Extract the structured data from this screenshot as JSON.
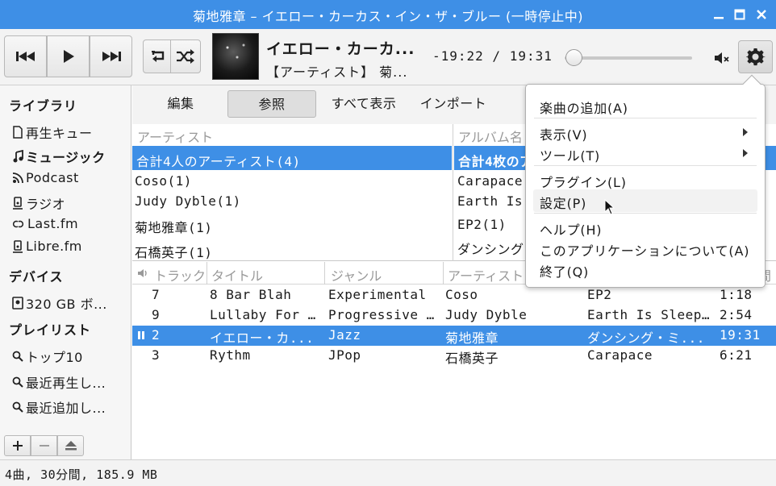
{
  "window": {
    "title": "菊地雅章 – イエロー・カーカス・イン・ザ・ブルー (一時停止中)"
  },
  "player": {
    "song_title": "イエロー・カーカ...",
    "song_artist": "【アーティスト】 菊...",
    "time": "-19:22 / 19:31",
    "progress": 0.006
  },
  "sidebar": {
    "library_header": "ライブラリ",
    "library_items": [
      "再生キュー",
      "ミュージック",
      "Podcast",
      "ラジオ",
      "Last.fm",
      "Libre.fm"
    ],
    "devices_header": "デバイス",
    "device_items": [
      "320 GB ボ..."
    ],
    "playlists_header": "プレイリスト",
    "playlist_items": [
      "トップ10",
      "最近再生し...",
      "最近追加し..."
    ]
  },
  "tabs": [
    "編集",
    "参照",
    "すべて表示",
    "インポート"
  ],
  "browser": {
    "artist_header": "アーティスト",
    "album_header": "アルバム名",
    "artists": [
      "合計4人のアーティスト(4)",
      "Coso(1)",
      "Judy Dyble(1)",
      "菊地雅章(1)",
      "石橋英子(1)"
    ],
    "albums": [
      "合計4枚のア",
      "Carapace",
      "Earth Is",
      "EP2(1)",
      "ダンシング"
    ]
  },
  "tracks": {
    "columns": [
      "トラック",
      "タイトル",
      "ジャンル",
      "アーティスト",
      "",
      "間"
    ],
    "rows": [
      {
        "track": "7",
        "title": "8 Bar Blah",
        "genre": "Experimental",
        "artist": "Coso",
        "album": "EP2",
        "time": "1:18"
      },
      {
        "track": "9",
        "title": "Lullaby For …",
        "genre": "Progressive …",
        "artist": "Judy Dyble",
        "album": "Earth Is Sleep…",
        "time": "2:54"
      },
      {
        "track": "2",
        "title": "イエロー・カ...",
        "genre": "Jazz",
        "artist": "菊地雅章",
        "album": "ダンシング・ミ...",
        "time": "19:31"
      },
      {
        "track": "3",
        "title": "Rythm",
        "genre": "JPop",
        "artist": "石橋英子",
        "album": "Carapace",
        "time": "6:21"
      }
    ]
  },
  "status": "4曲, 30分間, 185.9 MB",
  "menu": {
    "items": [
      "楽曲の追加(A)",
      "表示(V)",
      "ツール(T)",
      "プラグイン(L)",
      "設定(P)",
      "ヘルプ(H)",
      "このアプリケーションについて(A)",
      "終了(Q)"
    ]
  },
  "colors": {
    "accent": "#3e8fe6",
    "toolbar_bg": "#f3f3f3"
  }
}
